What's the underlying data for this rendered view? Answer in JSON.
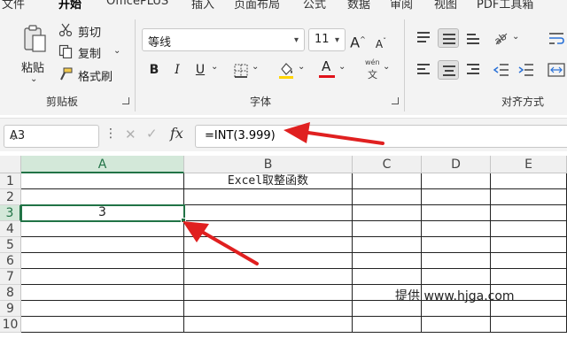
{
  "menu": {
    "tabs": [
      "文件",
      "开始",
      "OfficePLUS",
      "插入",
      "页面布局",
      "公式",
      "数据",
      "审阅",
      "视图",
      "PDF工具箱"
    ],
    "active": "开始"
  },
  "clipboard": {
    "paste_label": "粘贴",
    "cut_label": "剪切",
    "copy_label": "复制",
    "format_painter_label": "格式刷",
    "group_label": "剪贴板"
  },
  "font": {
    "family": "等线",
    "size": "11",
    "bold": "B",
    "italic": "I",
    "underline": "U",
    "font_color_glyph": "A",
    "phonetic_top": "wén",
    "phonetic_bottom": "文",
    "grow": "A",
    "shrink": "A",
    "group_label": "字体",
    "fill_color": "#ffd400",
    "font_color": "#e0121a"
  },
  "alignment": {
    "group_label": "对齐方式"
  },
  "formula_bar": {
    "name_box": "A3",
    "cancel_glyph": "✕",
    "enter_glyph": "✓",
    "fx_label": "fx",
    "formula": "=INT(3.999)"
  },
  "grid": {
    "columns": [
      "A",
      "B",
      "C",
      "D",
      "E"
    ],
    "active_column": "A",
    "rows": [
      "1",
      "2",
      "3",
      "4",
      "5",
      "6",
      "7",
      "8",
      "9",
      "10"
    ],
    "active_row": "3",
    "cells": {
      "B1": "Excel取整函数",
      "A3": "3"
    },
    "watermark": "提供 www.hjga.com"
  },
  "annotations": {
    "arrow_color": "#e02020"
  }
}
